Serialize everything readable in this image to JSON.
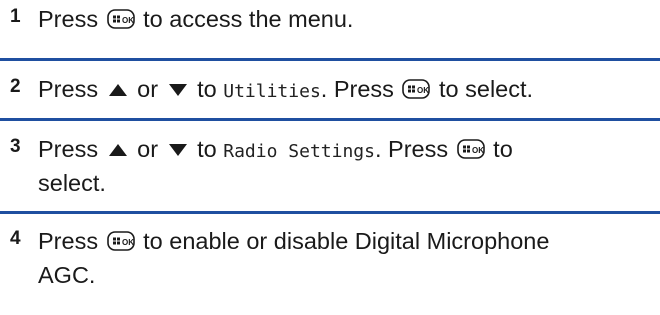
{
  "steps": [
    {
      "number": "1",
      "parts": {
        "press": "Press",
        "after_key": "to access the menu."
      }
    },
    {
      "number": "2",
      "parts": {
        "press": "Press",
        "or": "or",
        "to": "to",
        "menu_item": "Utilities",
        "press2": ". Press",
        "to_select": "to select."
      }
    },
    {
      "number": "3",
      "parts": {
        "press": "Press",
        "or": "or",
        "to": "to",
        "menu_item": "Radio Settings",
        "press2": ". Press",
        "to_end": "to",
        "line2": "select."
      }
    },
    {
      "number": "4",
      "parts": {
        "press": "Press",
        "after_key": "to enable or disable Digital Microphone",
        "line2": "AGC."
      }
    }
  ],
  "icons": {
    "menu_ok_key": "menu-ok-key-icon",
    "up_arrow": "up-triangle-icon",
    "down_arrow": "down-triangle-icon"
  },
  "colors": {
    "divider": "#1f4fa0",
    "text": "#1a1a1a"
  }
}
